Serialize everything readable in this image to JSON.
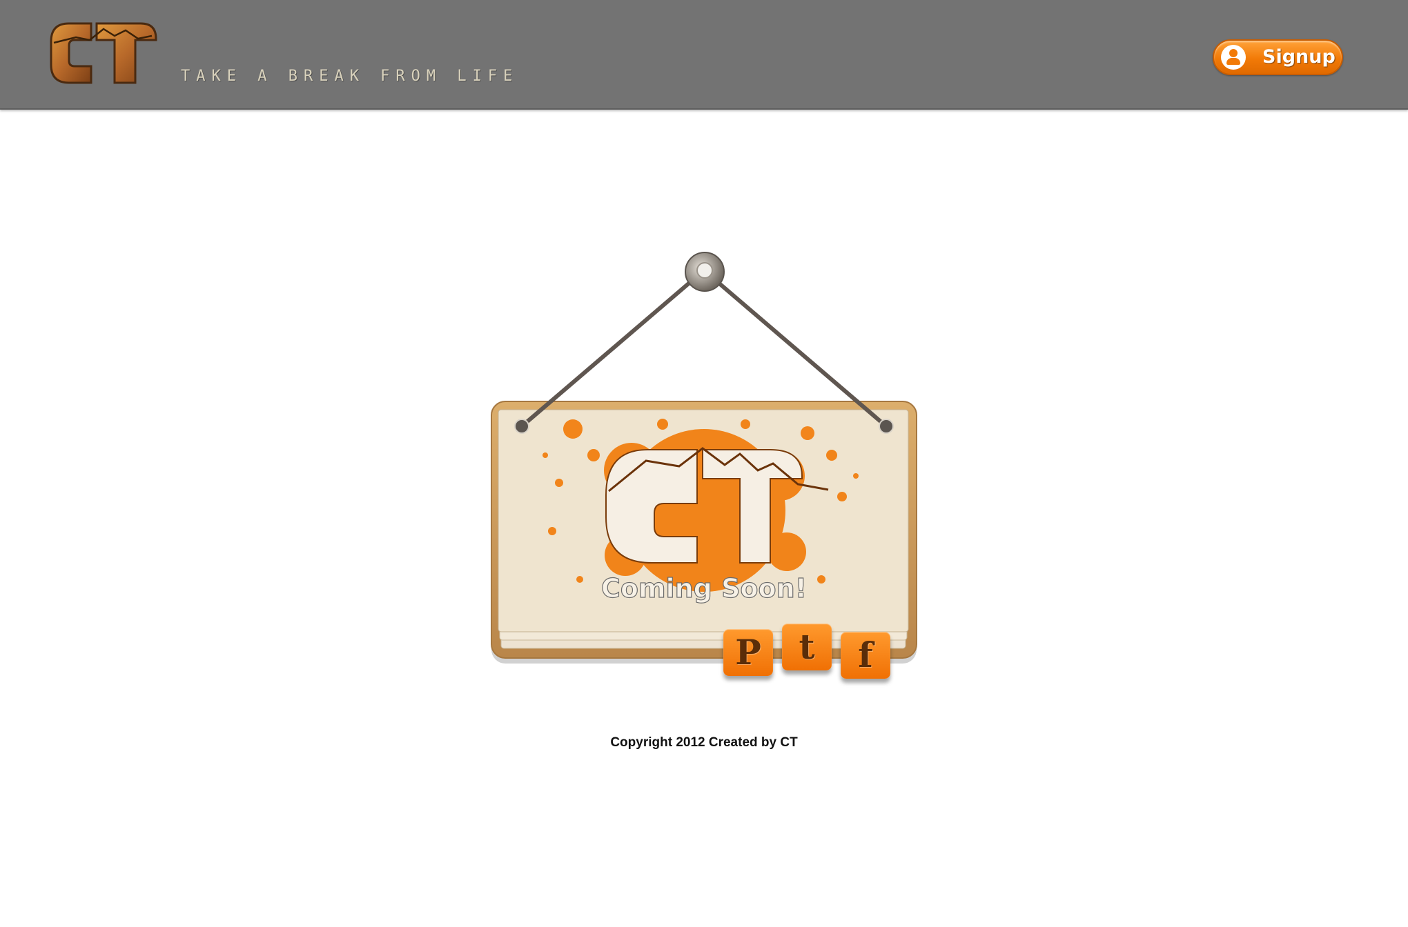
{
  "header": {
    "logo_text": "CT",
    "tagline": "TAKE A BREAK FROM LIFE",
    "signup_label": "Signup",
    "signup_icon": "user-icon"
  },
  "sign": {
    "logo_text": "CT",
    "caption": "Coming Soon!",
    "social": [
      {
        "name": "pinterest",
        "icon": "pinterest-icon",
        "glyph": "P"
      },
      {
        "name": "twitter",
        "icon": "twitter-icon",
        "glyph": "t"
      },
      {
        "name": "facebook",
        "icon": "facebook-icon",
        "glyph": "f"
      }
    ]
  },
  "footer": {
    "copyright": "Copyright 2012 Created by CT"
  },
  "colors": {
    "header_bg": "#737373",
    "accent": "#f27a07",
    "wood": "#c8954f",
    "paper": "#efe4cf"
  }
}
